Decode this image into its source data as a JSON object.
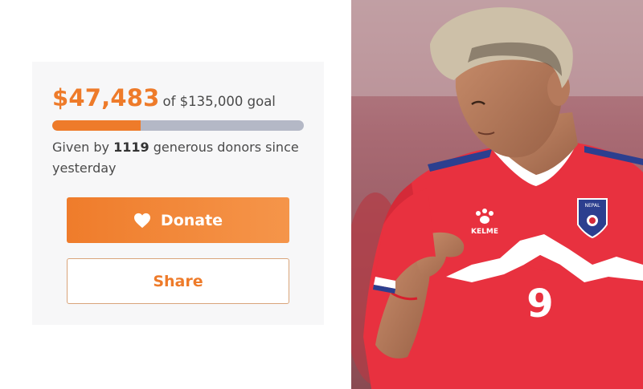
{
  "fundraiser": {
    "raised": "$47,483",
    "goal_text": "of $135,000 goal",
    "progress_fraction": 0.352,
    "donors_prefix": "Given by ",
    "donor_count": "1119",
    "donors_suffix": " generous donors since yesterday"
  },
  "actions": {
    "donate_label": "Donate",
    "share_label": "Share",
    "donate_icon": "heart-icon"
  },
  "photo": {
    "jersey_number": "9",
    "jersey_brand": "KELME",
    "badge_text": "NEPAL"
  },
  "colors": {
    "accent": "#ee7b2a",
    "track": "#b4b8c6",
    "card_bg": "#f7f7f8",
    "jersey": "#e8313f"
  }
}
